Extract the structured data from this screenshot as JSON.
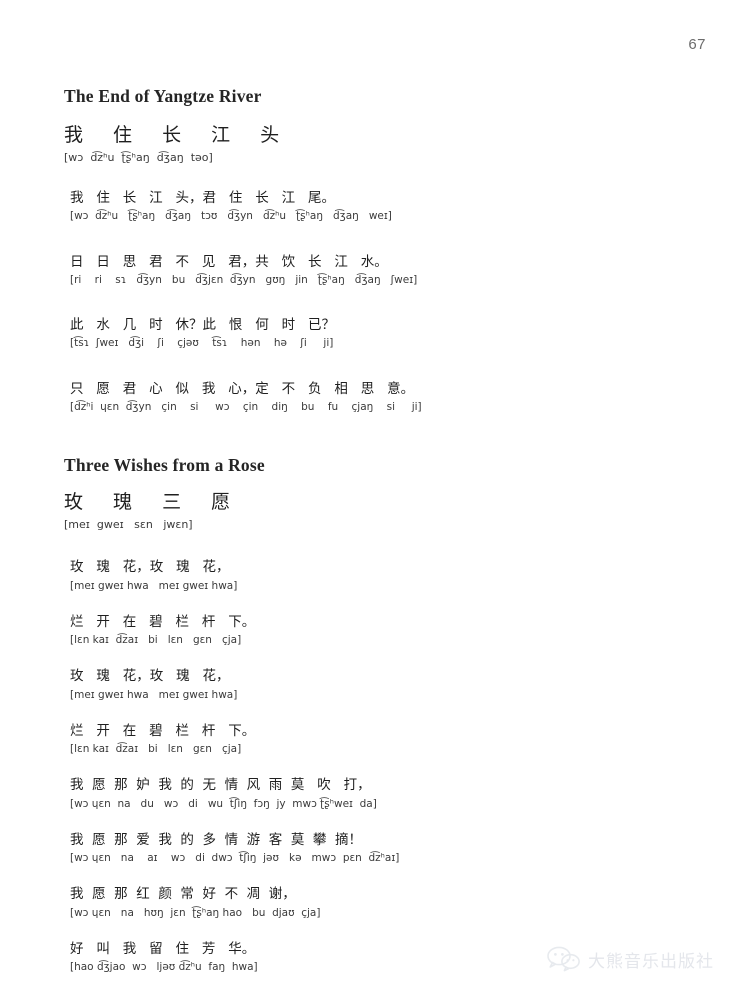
{
  "page": {
    "number": "67"
  },
  "songs": [
    {
      "english_title": "The End of Yangtze River",
      "heading": {
        "hanzi": "我 住 长 江 头",
        "ipa": "[wɔ  d͡zʰu  ʈ͡ʂʰaŋ  d͡ʒaŋ  təo]"
      },
      "verses": [
        {
          "hanzi": "我   住   长   江   头，君   住   长   江   尾。",
          "ipa": "[wɔ  d͡zʰu   ʈ͡ʂʰaŋ   d͡ʒaŋ   tɔʊ   d͡ʒyn   d͡zʰu   ʈ͡ʂʰaŋ   d͡ʒaŋ   weɪ]"
        },
        {
          "hanzi": "日   日   思   君   不   见   君，共   饮   长   江   水。",
          "ipa": "[ri    ri    sɿ   d͡ʒyn   bu   d͡ʒjɛn  d͡ʒyn   gʊŋ   jin   ʈ͡ʂʰaŋ   d͡ʒaŋ   ʃweɪ]"
        },
        {
          "hanzi": "此   水   几   时   休？此   恨   何   时   已？",
          "ipa": "[t͡sɿ  ʃweɪ   d͡ʒi    ʃi    çjəʊ    t͡sɿ    hən    hə    ʃi     ji]"
        },
        {
          "hanzi": "只   愿   君   心   似   我   心，定   不   负   相   思   意。",
          "ipa": "[d͡zʰi  ɥɛn  d͡ʒyn   çin    si     wɔ    çin    diŋ    bu    fu    çjaŋ    si     ji]"
        }
      ]
    },
    {
      "english_title": "Three Wishes from a Rose",
      "heading": {
        "hanzi": "玫 瑰 三 愿",
        "ipa": "[meɪ  gweɪ   sɛn   jwɛn]"
      },
      "verses": [
        {
          "hanzi": "玫   瑰   花，玫   瑰   花，",
          "ipa": "[meɪ gweɪ hwa   meɪ gweɪ hwa]"
        },
        {
          "hanzi": "烂   开   在   碧   栏   杆   下。",
          "ipa": "[lɛn kaɪ  d͡zaɪ   bi   lɛn   gɛn   çja]"
        },
        {
          "hanzi": "玫   瑰   花，玫   瑰   花，",
          "ipa": "[meɪ gweɪ hwa   meɪ gweɪ hwa]"
        },
        {
          "hanzi": "烂   开   在   碧   栏   杆   下。",
          "ipa": "[lɛn kaɪ  d͡zaɪ   bi   lɛn   gɛn   çja]"
        },
        {
          "hanzi": "我  愿  那  妒  我  的  无  情  风  雨  莫   吹   打，",
          "ipa": "[wɔ ɥɛn  na   du   wɔ   di   wu  t͡ʃiŋ  fɔŋ  jy  mwɔ ʈ͡ʂʰweɪ  da]"
        },
        {
          "hanzi": "我  愿  那  爱  我  的  多  情  游  客  莫  攀  摘！",
          "ipa": "[wɔ ɥɛn   na    aɪ    wɔ   di  dwɔ  t͡ʃiŋ  jəʊ   kə   mwɔ  pɛn  d͡zʰaɪ]"
        },
        {
          "hanzi": "我  愿  那  红  颜  常  好  不  凋  谢，",
          "ipa": "[wɔ ɥɛn   na   hʊŋ  jɛn  ʈ͡ʂʰaŋ hao   bu  djaʊ  çja]"
        },
        {
          "hanzi": "好   叫   我   留   住   芳   华。",
          "ipa": "[hao d͡ʒjao  wɔ   ljəʊ d͡zʰu  faŋ  hwa]"
        }
      ]
    }
  ],
  "watermark": {
    "text": "大熊音乐出版社",
    "icon": "wechat-icon"
  }
}
